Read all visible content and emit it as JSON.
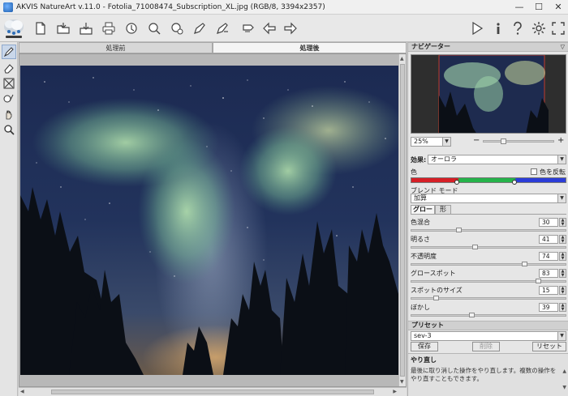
{
  "window": {
    "title": "AKVIS NatureArt v.11.0 - Fotolia_71008474_Subscription_XL.jpg (RGB/8, 3394x2357)",
    "minimize": "—",
    "maximize": "☐",
    "close": "✕"
  },
  "toolbar": {
    "icons": [
      "new-file-icon",
      "open-file-icon",
      "save-file-icon",
      "print-icon",
      "batch-icon",
      "export-icon",
      "import-icon",
      "share-icon",
      "preferences-icon",
      "undo-history-icon",
      "back-arrow-icon",
      "forward-arrow-icon",
      "run-icon",
      "info-icon",
      "help-icon",
      "settings-icon",
      "fullscreen-icon"
    ]
  },
  "tabs": {
    "before": "処理前",
    "after": "処理後"
  },
  "navigator": {
    "header": "ナビゲーター",
    "zoom": "25%",
    "zoom_out": "−",
    "zoom_in": "+"
  },
  "effect": {
    "label": "効果:",
    "value": "オーロラ"
  },
  "color": {
    "label": "色",
    "invert_label": "色を反転",
    "invert_checked": false
  },
  "blend": {
    "label": "ブレンド モード",
    "value": "加算"
  },
  "subtabs": {
    "glow": "グロー",
    "shape": "形"
  },
  "params": [
    {
      "label": "色混合",
      "value": "30",
      "pos": 0.3
    },
    {
      "label": "明るさ",
      "value": "41",
      "pos": 0.41
    },
    {
      "label": "不透明度",
      "value": "74",
      "pos": 0.74
    },
    {
      "label": "グロースポット",
      "value": "83",
      "pos": 0.83
    },
    {
      "label": "スポットのサイズ",
      "value": "15",
      "pos": 0.15
    },
    {
      "label": "ぼかし",
      "value": "39",
      "pos": 0.39
    }
  ],
  "presets": {
    "header": "プリセット",
    "value": "sev-3",
    "save": "保存",
    "delete": "削除",
    "reset": "リセット"
  },
  "hint": {
    "title": "やり直し",
    "text": "最後に取り消した操作をやり直します。複数の操作をやり直すこともできます。"
  }
}
